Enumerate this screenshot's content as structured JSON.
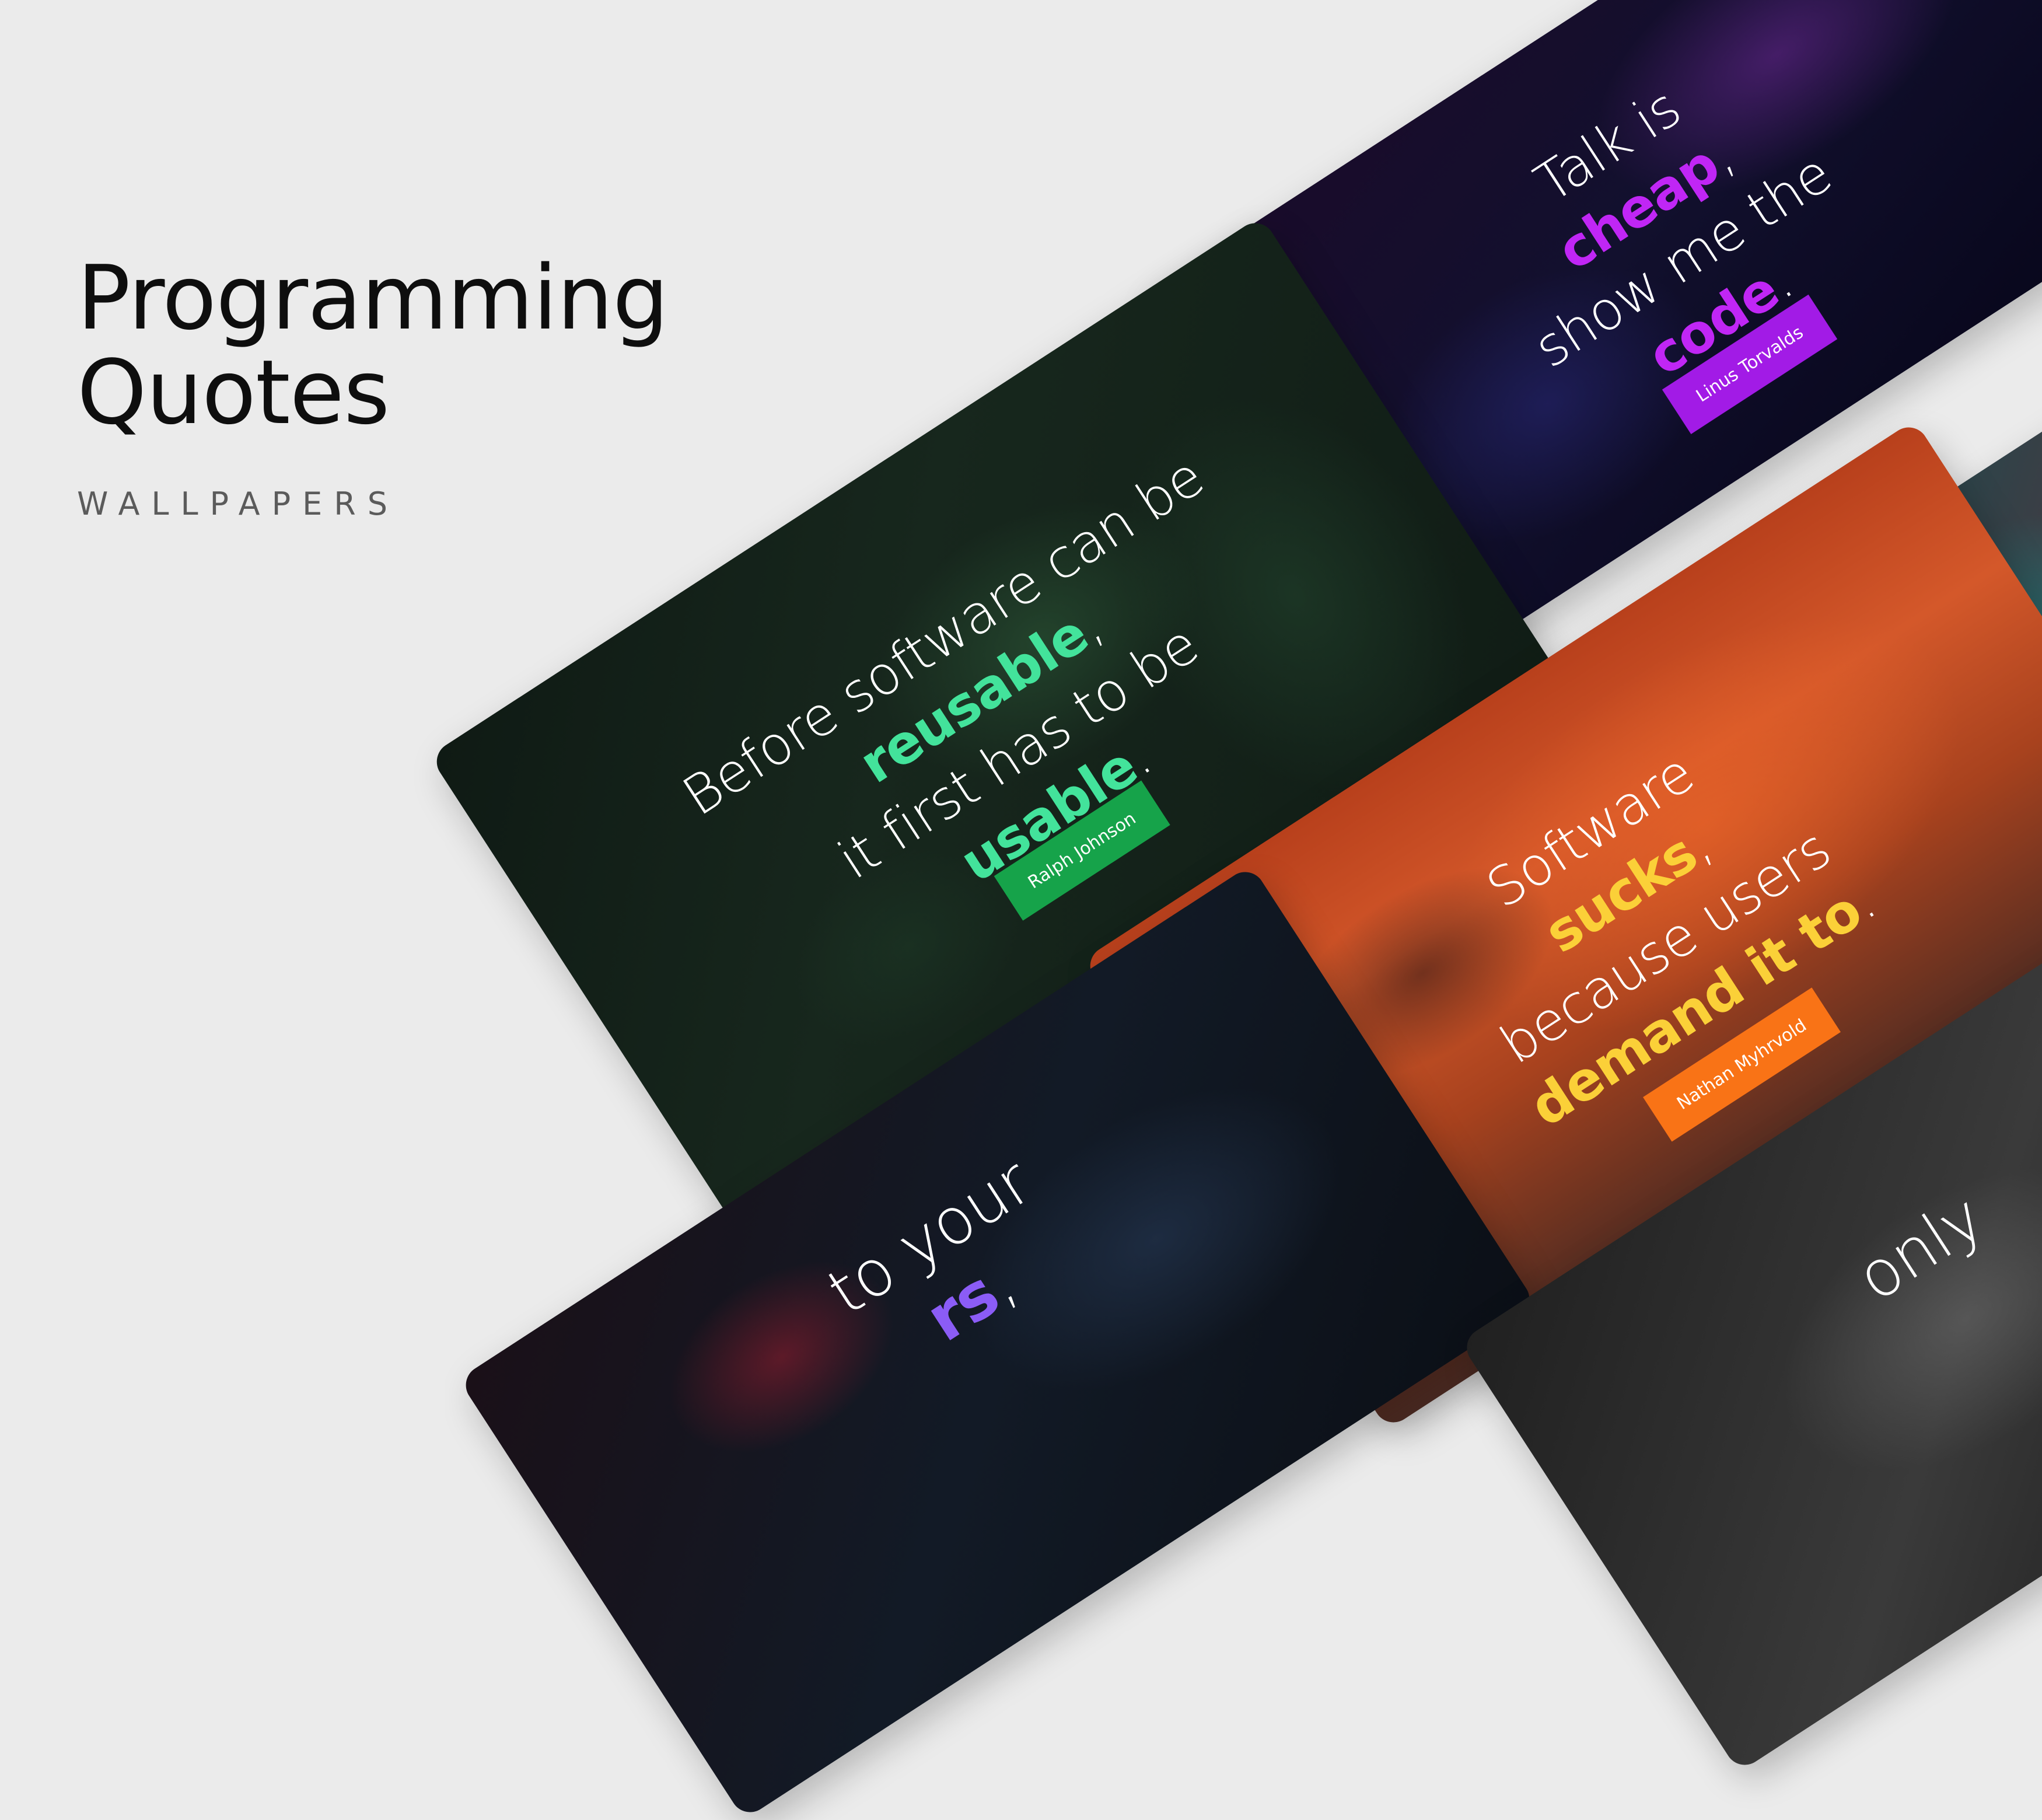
{
  "hero": {
    "title_line1": "Programming",
    "title_line2": "Quotes",
    "subtitle": "WALLPAPERS"
  },
  "cards": {
    "jungle": {
      "line1": "Before software can be",
      "line2_hl": "reusable",
      "line2_rest": ",",
      "line3": "it first has to be",
      "line4_hl": "usable",
      "line4_rest": ".",
      "author": "Ralph Johnson"
    },
    "keyboard": {
      "line1": "Talk is",
      "line2_hl": "cheap",
      "line2_rest": ",",
      "line3": "show me the",
      "line4_hl": "code",
      "line4_rest": ".",
      "author": "Linus Torvalds"
    },
    "sunset": {
      "line1": "Software",
      "line2_hl": "sucks",
      "line2_rest": ",",
      "line3": "because users",
      "line4_hl": "demand it to",
      "line4_rest": ".",
      "author": "Nathan Myhrvold"
    },
    "stadium": {
      "line1_rest": "to your",
      "line2_hl": "rs",
      "line2_rest": ","
    },
    "grey": {
      "line1": "only"
    }
  },
  "colors": {
    "background": "#ebebeb",
    "jungle_accent": "#43e39b",
    "jungle_badge": "#16a34a",
    "keyboard_accent": "#c026f5",
    "keyboard_badge": "#a21be6",
    "sunset_accent": "#fbd038",
    "sunset_badge": "#f97316",
    "stadium_accent": "#8b5cf6"
  }
}
